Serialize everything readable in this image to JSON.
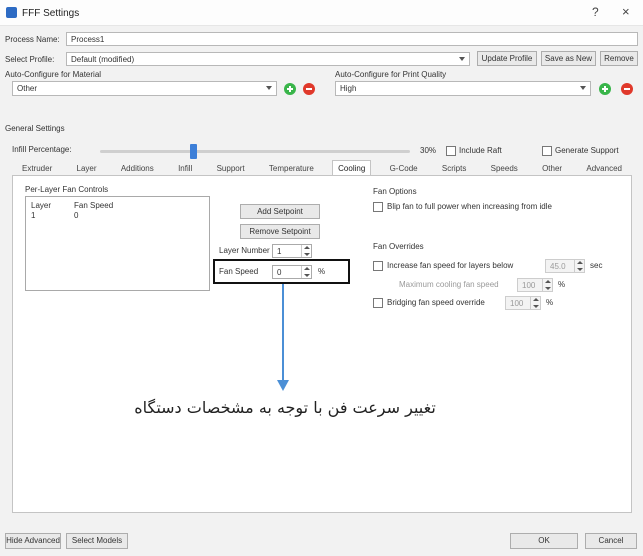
{
  "window": {
    "title": "FFF Settings",
    "help": "?",
    "close": "×"
  },
  "process": {
    "label": "Process Name:",
    "value": "Process1"
  },
  "profile": {
    "label": "Select Profile:",
    "value": "Default (modified)",
    "update": "Update Profile",
    "save_new": "Save as New",
    "remove": "Remove"
  },
  "auto_configure": {
    "material_label": "Auto-Configure for Material",
    "material_value": "Other",
    "quality_label": "Auto-Configure for Print Quality",
    "quality_value": "High"
  },
  "general": {
    "label": "General Settings",
    "infill_label": "Infill Percentage:",
    "infill_value": "30%",
    "infill_level": 0.3,
    "include_raft": {
      "label": "Include Raft",
      "checked": false
    },
    "generate_support": {
      "label": "Generate Support",
      "checked": false
    }
  },
  "tabs": [
    {
      "label": "Extruder"
    },
    {
      "label": "Layer"
    },
    {
      "label": "Additions"
    },
    {
      "label": "Infill"
    },
    {
      "label": "Support"
    },
    {
      "label": "Temperature"
    },
    {
      "label": "Cooling",
      "active": true
    },
    {
      "label": "G-Code"
    },
    {
      "label": "Scripts"
    },
    {
      "label": "Speeds"
    },
    {
      "label": "Other"
    },
    {
      "label": "Advanced"
    }
  ],
  "cooling": {
    "per_layer_label": "Per-Layer Fan Controls",
    "table": {
      "headers": [
        "Layer",
        "Fan Speed"
      ],
      "rows": [
        [
          "1",
          "0"
        ]
      ]
    },
    "add_setpoint": "Add Setpoint",
    "remove_setpoint": "Remove Setpoint",
    "layer_number_label": "Layer Number",
    "layer_number_value": "1",
    "fan_speed_label": "Fan Speed",
    "fan_speed_value": "0",
    "fan_speed_unit": "%",
    "fan_options_label": "Fan Options",
    "blip": {
      "label": "Blip fan to full power when increasing from idle",
      "checked": false
    },
    "fan_overrides_label": "Fan Overrides",
    "increase": {
      "label": "Increase fan speed for layers below",
      "checked": false,
      "value": "45.0",
      "unit": "sec"
    },
    "max_cooling": {
      "label": "Maximum cooling fan speed",
      "value": "100",
      "unit": "%"
    },
    "bridging": {
      "label": "Bridging fan speed override",
      "checked": false,
      "value": "100",
      "unit": "%"
    }
  },
  "annotation": {
    "text": "تغییر سرعت فن با توجه به مشخصات دستگاه"
  },
  "footer": {
    "hide_advanced": "Hide Advanced",
    "select_models": "Select Models",
    "ok": "OK",
    "cancel": "Cancel"
  },
  "icons": {
    "app": "app-icon",
    "add": "add-circle-icon",
    "remove": "remove-circle-icon",
    "dropdown": "chevron-down-icon",
    "spin": "spin-arrows-icon"
  },
  "colors": {
    "annotation_arrow": "#4b8fd6",
    "highlight_box": "#111111",
    "add_icon": "#39b54a",
    "remove_icon": "#e0392b",
    "slider_thumb": "#3d7fd8"
  }
}
